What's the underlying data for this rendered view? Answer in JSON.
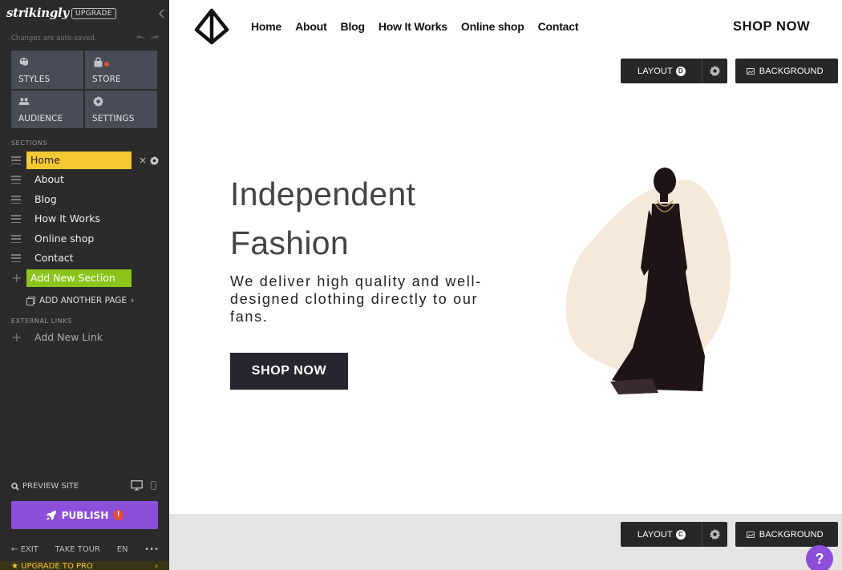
{
  "sidebar": {
    "logo": "strikingly",
    "upgrade_badge": "UPGRADE",
    "autosave": "Changes are auto-saved.",
    "tiles": [
      {
        "label": "STYLES",
        "icon": "palette-icon"
      },
      {
        "label": "STORE",
        "icon": "shopping-bag-icon"
      },
      {
        "label": "AUDIENCE",
        "icon": "people-icon"
      },
      {
        "label": "SETTINGS",
        "icon": "gear-icon"
      }
    ],
    "sections_header": "SECTIONS",
    "sections": [
      {
        "label": "Home",
        "active": true
      },
      {
        "label": "About"
      },
      {
        "label": "Blog"
      },
      {
        "label": "How It Works"
      },
      {
        "label": "Online shop"
      },
      {
        "label": "Contact"
      }
    ],
    "add_section": "Add New Section",
    "add_page": "ADD ANOTHER PAGE",
    "external_header": "EXTERNAL LINKS",
    "add_link": "Add New Link",
    "preview": "PREVIEW SITE",
    "publish": "PUBLISH",
    "publish_alert": "!",
    "footer": {
      "exit": "EXIT",
      "tour": "TAKE TOUR",
      "lang": "EN",
      "more": "•••"
    },
    "upgrade_pro": "UPGRADE TO PRO",
    "colors": {
      "bg": "#2b2b2b",
      "active": "#f6c932",
      "add": "#8cc41c",
      "publish": "#8c4fd9"
    }
  },
  "site": {
    "nav": [
      "Home",
      "About",
      "Blog",
      "How It Works",
      "Online shop",
      "Contact"
    ],
    "shop_now_top": "SHOP NOW",
    "toolbar_top": {
      "layout": "LAYOUT",
      "layout_badge": "D",
      "background": "BACKGROUND"
    },
    "hero": {
      "title_line1": "Independent",
      "title_line2": "Fashion",
      "subtitle": "We deliver high quality and well-designed clothing directly to our fans.",
      "button": "SHOP NOW"
    },
    "toolbar_bottom": {
      "layout": "LAYOUT",
      "layout_badge": "C",
      "background": "BACKGROUND"
    },
    "help": "?"
  }
}
